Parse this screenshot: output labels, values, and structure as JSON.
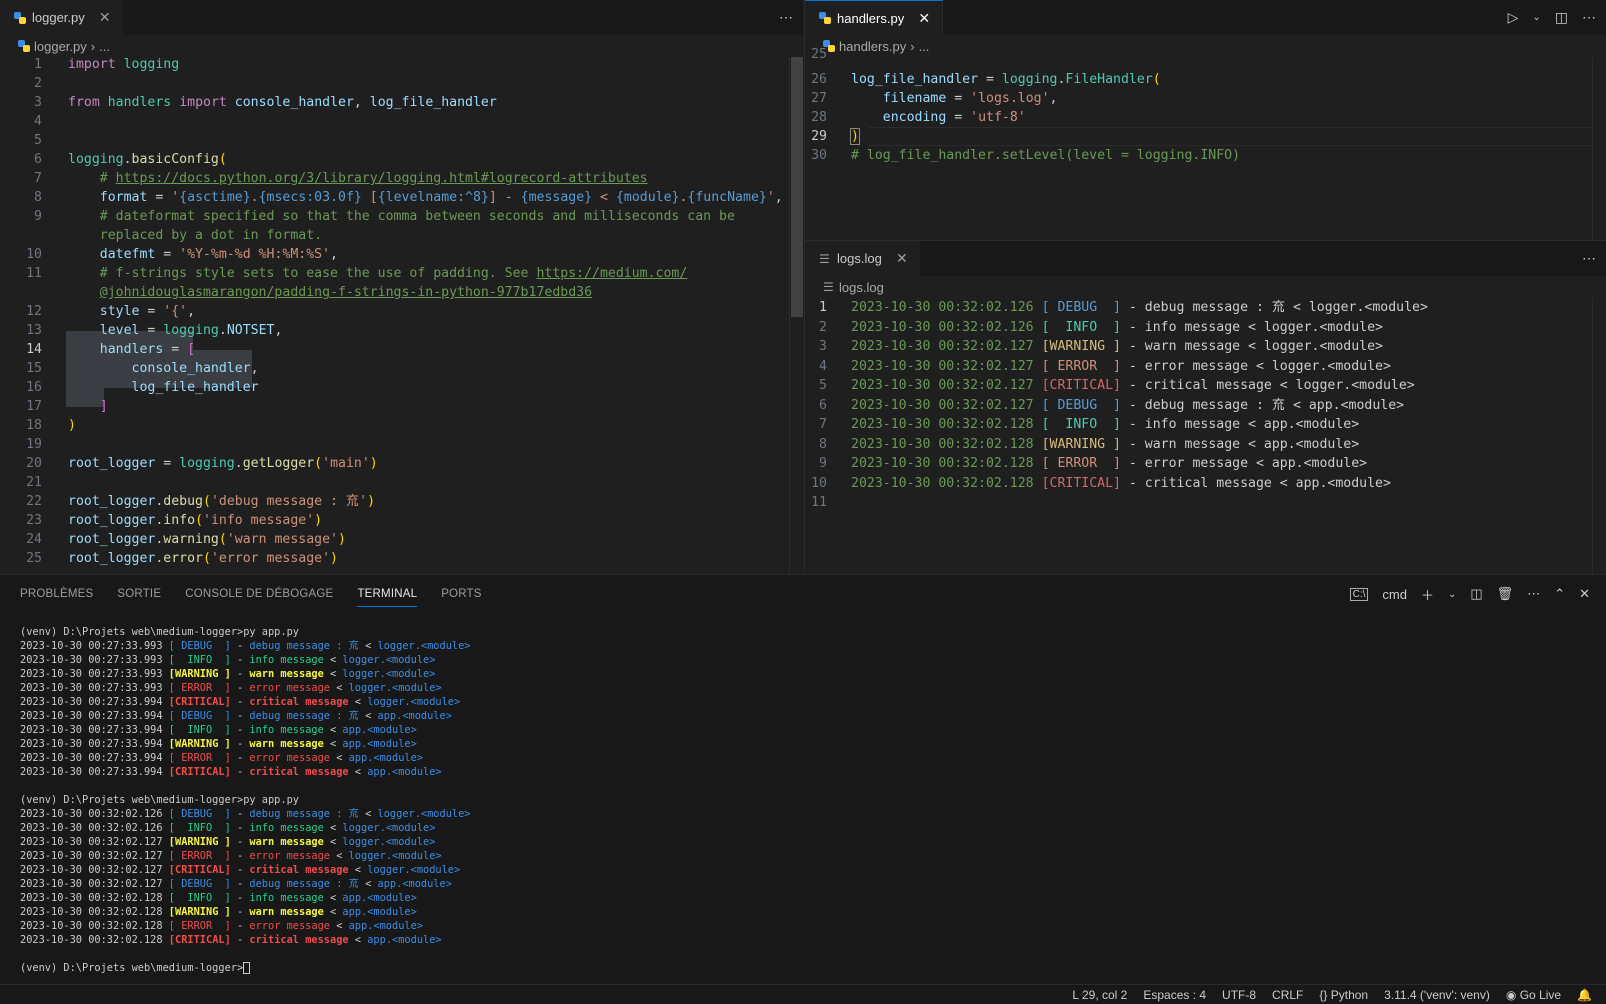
{
  "left_editor": {
    "tab_label": "logger.py",
    "breadcrumb": [
      "logger.py",
      "..."
    ],
    "more_icon": "ellipsis-icon"
  },
  "right_editor": {
    "tab_label": "handlers.py",
    "breadcrumb": [
      "handlers.py",
      "..."
    ],
    "actions": [
      "run-icon",
      "chevron-down-icon",
      "split-editor-icon",
      "ellipsis-icon"
    ],
    "line_numbers": [
      "25",
      "26",
      "27",
      "28",
      "29",
      "30"
    ]
  },
  "logs_editor": {
    "tab_label": "logs.log",
    "breadcrumb": [
      "logs.log"
    ],
    "lines": [
      {
        "ts": "2023-10-30 00:32:02.126",
        "lvl": "[ DEBUG  ]",
        "msg": " - debug message : 㐬 < logger.<module>",
        "cls": "dbg"
      },
      {
        "ts": "2023-10-30 00:32:02.126",
        "lvl": "[  INFO  ]",
        "msg": " - info message < logger.<module>",
        "cls": "inf"
      },
      {
        "ts": "2023-10-30 00:32:02.127",
        "lvl": "[WARNING ]",
        "msg": " - warn message < logger.<module>",
        "cls": "wrn"
      },
      {
        "ts": "2023-10-30 00:32:02.127",
        "lvl": "[ ERROR  ]",
        "msg": " - error message < logger.<module>",
        "cls": "err"
      },
      {
        "ts": "2023-10-30 00:32:02.127",
        "lvl": "[CRITICAL]",
        "msg": " - critical message < logger.<module>",
        "cls": "crt"
      },
      {
        "ts": "2023-10-30 00:32:02.127",
        "lvl": "[ DEBUG  ]",
        "msg": " - debug message : 㐬 < app.<module>",
        "cls": "dbg"
      },
      {
        "ts": "2023-10-30 00:32:02.128",
        "lvl": "[  INFO  ]",
        "msg": " - info message < app.<module>",
        "cls": "inf"
      },
      {
        "ts": "2023-10-30 00:32:02.128",
        "lvl": "[WARNING ]",
        "msg": " - warn message < app.<module>",
        "cls": "wrn"
      },
      {
        "ts": "2023-10-30 00:32:02.128",
        "lvl": "[ ERROR  ]",
        "msg": " - error message < app.<module>",
        "cls": "err"
      },
      {
        "ts": "2023-10-30 00:32:02.128",
        "lvl": "[CRITICAL]",
        "msg": " - critical message < app.<module>",
        "cls": "crt"
      }
    ],
    "line_numbers": [
      "1",
      "2",
      "3",
      "4",
      "5",
      "6",
      "7",
      "8",
      "9",
      "10",
      "11"
    ]
  },
  "panel": {
    "tabs": [
      "PROBLÈMES",
      "SORTIE",
      "CONSOLE DE DÉBOGAGE",
      "TERMINAL",
      "PORTS"
    ],
    "active_tab": "TERMINAL",
    "shell_label": "cmd",
    "prompt": "(venv) D:\\Projets web\\medium-logger>",
    "command": "py app.py",
    "runs": [
      [
        {
          "ts": "2023-10-30 00:27:33.993",
          "lvl": "[ DEBUG  ]",
          "msg": "debug message : 㐬",
          "mod": "logger.<module>",
          "cls": "tdbg"
        },
        {
          "ts": "2023-10-30 00:27:33.993",
          "lvl": "[  INFO  ]",
          "msg": "info message",
          "mod": "logger.<module>",
          "cls": "tinf"
        },
        {
          "ts": "2023-10-30 00:27:33.993",
          "lvl": "[WARNING ]",
          "msg": "warn message",
          "mod": "logger.<module>",
          "cls": "twrn"
        },
        {
          "ts": "2023-10-30 00:27:33.993",
          "lvl": "[ ERROR  ]",
          "msg": "error message",
          "mod": "logger.<module>",
          "cls": "terr"
        },
        {
          "ts": "2023-10-30 00:27:33.994",
          "lvl": "[CRITICAL]",
          "msg": "critical message",
          "mod": "logger.<module>",
          "cls": "tcrt"
        },
        {
          "ts": "2023-10-30 00:27:33.994",
          "lvl": "[ DEBUG  ]",
          "msg": "debug message : 㐬",
          "mod": "app.<module>",
          "cls": "tdbg"
        },
        {
          "ts": "2023-10-30 00:27:33.994",
          "lvl": "[  INFO  ]",
          "msg": "info message",
          "mod": "app.<module>",
          "cls": "tinf"
        },
        {
          "ts": "2023-10-30 00:27:33.994",
          "lvl": "[WARNING ]",
          "msg": "warn message",
          "mod": "app.<module>",
          "cls": "twrn"
        },
        {
          "ts": "2023-10-30 00:27:33.994",
          "lvl": "[ ERROR  ]",
          "msg": "error message",
          "mod": "app.<module>",
          "cls": "terr"
        },
        {
          "ts": "2023-10-30 00:27:33.994",
          "lvl": "[CRITICAL]",
          "msg": "critical message",
          "mod": "app.<module>",
          "cls": "tcrt"
        }
      ],
      [
        {
          "ts": "2023-10-30 00:32:02.126",
          "lvl": "[ DEBUG  ]",
          "msg": "debug message : 㐬",
          "mod": "logger.<module>",
          "cls": "tdbg"
        },
        {
          "ts": "2023-10-30 00:32:02.126",
          "lvl": "[  INFO  ]",
          "msg": "info message",
          "mod": "logger.<module>",
          "cls": "tinf"
        },
        {
          "ts": "2023-10-30 00:32:02.127",
          "lvl": "[WARNING ]",
          "msg": "warn message",
          "mod": "logger.<module>",
          "cls": "twrn"
        },
        {
          "ts": "2023-10-30 00:32:02.127",
          "lvl": "[ ERROR  ]",
          "msg": "error message",
          "mod": "logger.<module>",
          "cls": "terr"
        },
        {
          "ts": "2023-10-30 00:32:02.127",
          "lvl": "[CRITICAL]",
          "msg": "critical message",
          "mod": "logger.<module>",
          "cls": "tcrt"
        },
        {
          "ts": "2023-10-30 00:32:02.127",
          "lvl": "[ DEBUG  ]",
          "msg": "debug message : 㐬",
          "mod": "app.<module>",
          "cls": "tdbg"
        },
        {
          "ts": "2023-10-30 00:32:02.128",
          "lvl": "[  INFO  ]",
          "msg": "info message",
          "mod": "app.<module>",
          "cls": "tinf"
        },
        {
          "ts": "2023-10-30 00:32:02.128",
          "lvl": "[WARNING ]",
          "msg": "warn message",
          "mod": "app.<module>",
          "cls": "twrn"
        },
        {
          "ts": "2023-10-30 00:32:02.128",
          "lvl": "[ ERROR  ]",
          "msg": "error message",
          "mod": "app.<module>",
          "cls": "terr"
        },
        {
          "ts": "2023-10-30 00:32:02.128",
          "lvl": "[CRITICAL]",
          "msg": "critical message",
          "mod": "app.<module>",
          "cls": "tcrt"
        }
      ]
    ]
  },
  "status_bar": {
    "position": "L 29, col 2",
    "indent": "Espaces : 4",
    "encoding": "UTF-8",
    "eol": "CRLF",
    "language": "Python",
    "interpreter": "3.11.4 ('venv': venv)",
    "go_live": "Go Live"
  },
  "colors": {
    "accent": "#0078d4",
    "editor_bg": "#1f1f1f",
    "panel_bg": "#181818"
  }
}
